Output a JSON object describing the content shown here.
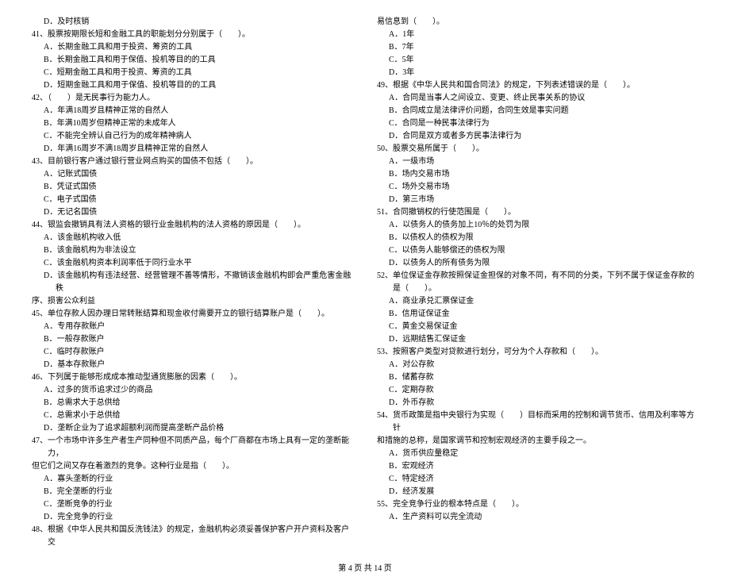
{
  "left_column": [
    {
      "text": "D．及时核销",
      "cls": "option"
    },
    {
      "text": "41、股票按期限长短和金融工具的职能划分分别属于（　　）。",
      "cls": "question-stem"
    },
    {
      "text": "A．长期金融工具和用于投资、筹资的工具",
      "cls": "option"
    },
    {
      "text": "B．长期金融工具和用于保值、投机等目的的工具",
      "cls": "option"
    },
    {
      "text": "C．短期金融工具和用于投资、筹资的工具",
      "cls": "option"
    },
    {
      "text": "D．短期金融工具和用于保值、投机等目的的工具",
      "cls": "option"
    },
    {
      "text": "42、（　　）是无民事行为能力人。",
      "cls": "question-stem"
    },
    {
      "text": "A．年满18周岁且精神正常的自然人",
      "cls": "option"
    },
    {
      "text": "B．年满10周岁但精神正常的未成年人",
      "cls": "option"
    },
    {
      "text": "C．不能完全辨认自己行为的成年精神病人",
      "cls": "option"
    },
    {
      "text": "D．年满16周岁不满18周岁且精神正常的自然人",
      "cls": "option"
    },
    {
      "text": "43、目前银行客户通过银行营业网点购买的国债不包括（　　）。",
      "cls": "question-stem"
    },
    {
      "text": "A．记账式国债",
      "cls": "option"
    },
    {
      "text": "B．凭证式国债",
      "cls": "option"
    },
    {
      "text": "C．电子式国债",
      "cls": "option"
    },
    {
      "text": "D．无记名国债",
      "cls": "option"
    },
    {
      "text": "44、银监会撤销具有法人资格的银行业金融机构的法人资格的原因是（　　）。",
      "cls": "question-stem"
    },
    {
      "text": "A．该金融机构收入低",
      "cls": "option"
    },
    {
      "text": "B．该金融机构为非法设立",
      "cls": "option"
    },
    {
      "text": "C．该金融机构资本利润率低于同行业水平",
      "cls": "option"
    },
    {
      "text": "D．该金融机构有违法经营、经营管理不善等情形，不撤销该金融机构即会严重危害金融秩",
      "cls": "option"
    },
    {
      "text": "序、损害公众利益",
      "cls": "continuation"
    },
    {
      "text": "45、单位存款人因办理日常转账结算和现金收付需要开立的银行结算账户是（　　）。",
      "cls": "question-stem"
    },
    {
      "text": "A．专用存款账户",
      "cls": "option"
    },
    {
      "text": "B．一般存款账户",
      "cls": "option"
    },
    {
      "text": "C．临时存款账户",
      "cls": "option"
    },
    {
      "text": "D．基本存款账户",
      "cls": "option"
    },
    {
      "text": "46、下列属于能够形成成本推动型通货膨胀的因素（　　）。",
      "cls": "question-stem"
    },
    {
      "text": "A．过多的货币追求过少的商品",
      "cls": "option"
    },
    {
      "text": "B．总需求大于总供给",
      "cls": "option"
    },
    {
      "text": "C．总需求小于总供给",
      "cls": "option"
    },
    {
      "text": "D．垄断企业为了追求超额利润而提高垄断产品价格",
      "cls": "option"
    },
    {
      "text": "47、一个市场中许多生产者生产同种但不同质产品，每个厂商都在市场上具有一定的垄断能力，",
      "cls": "question-stem"
    },
    {
      "text": "但它们之间又存在着激烈的竞争。这种行业是指（　　）。",
      "cls": "continuation"
    },
    {
      "text": "A．寡头垄断的行业",
      "cls": "option"
    },
    {
      "text": "B．完全垄断的行业",
      "cls": "option"
    },
    {
      "text": "C．垄断竞争的行业",
      "cls": "option"
    },
    {
      "text": "D．完全竞争的行业",
      "cls": "option"
    },
    {
      "text": "48、根据《中华人民共和国反洗钱法》的规定，金融机构必须妥善保护客户开户资料及客户交",
      "cls": "question-stem"
    }
  ],
  "right_column": [
    {
      "text": "易信息到（　　）。",
      "cls": "continuation"
    },
    {
      "text": "A．1年",
      "cls": "option"
    },
    {
      "text": "B．7年",
      "cls": "option"
    },
    {
      "text": "C．5年",
      "cls": "option"
    },
    {
      "text": "D．3年",
      "cls": "option"
    },
    {
      "text": "49、根据《中华人民共和国合同法》的规定，下列表述错误的是（　　）。",
      "cls": "question-stem"
    },
    {
      "text": "A．合同是当事人之间设立、变更、终止民事关系的协议",
      "cls": "option"
    },
    {
      "text": "B．合同成立是法律评价问题，合同生效是事实问题",
      "cls": "option"
    },
    {
      "text": "C．合同是一种民事法律行为",
      "cls": "option"
    },
    {
      "text": "D．合同是双方或者多方民事法律行为",
      "cls": "option"
    },
    {
      "text": "50、股票交易所属于（　　）。",
      "cls": "question-stem"
    },
    {
      "text": "A．一级市场",
      "cls": "option"
    },
    {
      "text": "B．场内交易市场",
      "cls": "option"
    },
    {
      "text": "C．场外交易市场",
      "cls": "option"
    },
    {
      "text": "D．第三市场",
      "cls": "option"
    },
    {
      "text": "51、合同撤销权的行使范围是（　　）。",
      "cls": "question-stem"
    },
    {
      "text": "A．以债务人的债务加上10％的处罚为限",
      "cls": "option"
    },
    {
      "text": "B．以债权人的债权为限",
      "cls": "option"
    },
    {
      "text": "C．以债务人能够偿还的债权为限",
      "cls": "option"
    },
    {
      "text": "D．以债务人的所有债务为限",
      "cls": "option"
    },
    {
      "text": "52、单位保证金存款按照保证金担保的对象不同，有不同的分类，下列不属于保证金存款的是（　　）。",
      "cls": "question-stem"
    },
    {
      "text": "A．商业承兑汇票保证金",
      "cls": "option"
    },
    {
      "text": "B．信用证保证金",
      "cls": "option"
    },
    {
      "text": "C．黄金交易保证金",
      "cls": "option"
    },
    {
      "text": "D．远期结售汇保证金",
      "cls": "option"
    },
    {
      "text": "53、按照客户类型对贷款进行划分，可分为个人存款和（　　）。",
      "cls": "question-stem"
    },
    {
      "text": "A．对公存款",
      "cls": "option"
    },
    {
      "text": "B．储蓄存款",
      "cls": "option"
    },
    {
      "text": "C．定期存款",
      "cls": "option"
    },
    {
      "text": "D．外币存款",
      "cls": "option"
    },
    {
      "text": "54、货币政策是指中央银行为实现（　　）目标而采用的控制和调节货币、信用及利率等方针",
      "cls": "question-stem"
    },
    {
      "text": "和措施的总称，是国家调节和控制宏观经济的主要手段之一。",
      "cls": "continuation"
    },
    {
      "text": "A．货币供应量稳定",
      "cls": "option"
    },
    {
      "text": "B．宏观经济",
      "cls": "option"
    },
    {
      "text": "C．特定经济",
      "cls": "option"
    },
    {
      "text": "D．经济发展",
      "cls": "option"
    },
    {
      "text": "55、完全竞争行业的根本特点是（　　）。",
      "cls": "question-stem"
    },
    {
      "text": "A．生产资料可以完全流动",
      "cls": "option"
    }
  ],
  "footer": "第 4 页 共 14 页"
}
